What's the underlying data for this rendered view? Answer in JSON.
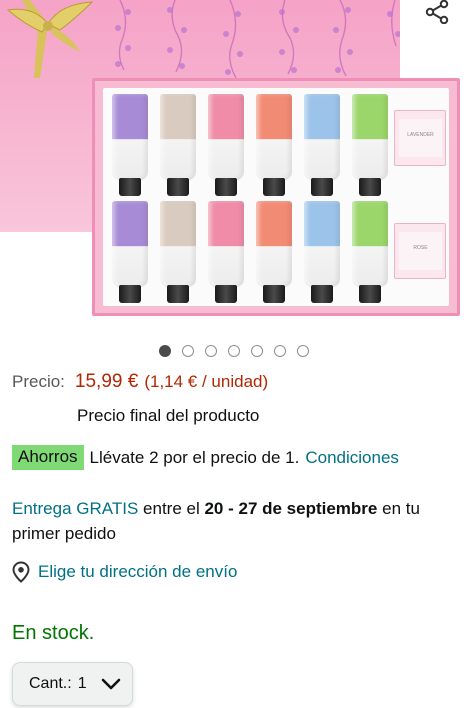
{
  "product": {
    "soap_labels": [
      "LAVENDER",
      "ROSE"
    ],
    "tube_colors_top": [
      "#a78bd6",
      "#d9cbbf",
      "#f08ca8",
      "#f28b74",
      "#9cc3ea",
      "#9bd66a"
    ],
    "tube_colors_bottom": [
      "#a78bd6",
      "#d9cbbf",
      "#f08ca8",
      "#f28b74",
      "#9cc3ea",
      "#9bd66a"
    ]
  },
  "carousel": {
    "count": 7,
    "active_index": 0
  },
  "price": {
    "label": "Precio:",
    "value": "15,99 €",
    "unit_price": "(1,14 € / unidad)",
    "final_note": "Precio final del producto"
  },
  "savings": {
    "badge": "Ahorros",
    "text": "Llévate 2 por el precio de 1.",
    "link": "Condiciones"
  },
  "delivery": {
    "link": "Entrega GRATIS",
    "text_before_dates": "entre el",
    "dates": "20 - 27 de septiembre",
    "text_after_dates": "en tu primer pedido"
  },
  "address": {
    "link": "Elige tu dirección de envío"
  },
  "stock": {
    "status": "En stock."
  },
  "quantity": {
    "label": "Cant.:",
    "value": "1"
  },
  "colors": {
    "price": "#b12704",
    "link": "#007185",
    "in_stock": "#007600",
    "savings_badge": "#7fda75"
  },
  "icons": [
    "share-icon",
    "location-pin-icon",
    "chevron-down-icon"
  ]
}
